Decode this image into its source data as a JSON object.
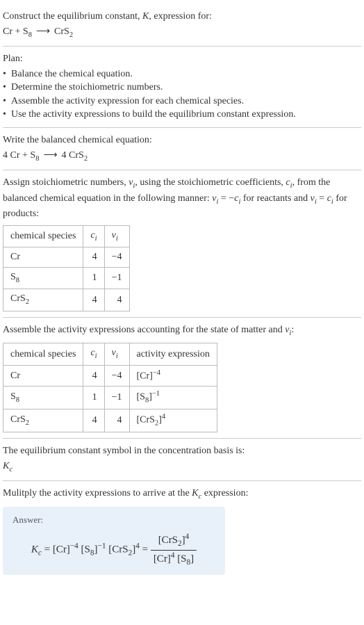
{
  "header": {
    "prompt": "Construct the equilibrium constant, ",
    "Ksym": "K",
    "prompt2": ", expression for:",
    "reactant1": "Cr",
    "plus": " + ",
    "reactant2a": "S",
    "reactant2sub": "8",
    "arrow": "⟶",
    "product1a": "CrS",
    "product1sub": "2"
  },
  "plan": {
    "title": "Plan:",
    "items": [
      "Balance the chemical equation.",
      "Determine the stoichiometric numbers.",
      "Assemble the activity expression for each chemical species.",
      "Use the activity expressions to build the equilibrium constant expression."
    ]
  },
  "balanced": {
    "title": "Write the balanced chemical equation:",
    "c1": "4 Cr",
    "plus": " + ",
    "c2a": "S",
    "c2sub": "8",
    "arrow": "⟶",
    "c3a": "4 CrS",
    "c3sub": "2"
  },
  "stoich": {
    "intro1": "Assign stoichiometric numbers, ",
    "nu": "ν",
    "isub": "i",
    "intro2": ", using the stoichiometric coefficients, ",
    "c": "c",
    "intro3": ", from the balanced chemical equation in the following manner: ",
    "rel1a": "ν",
    "rel1b": " = −",
    "rel1c": "c",
    "intro4": " for reactants and ",
    "rel2a": "ν",
    "rel2b": " = ",
    "rel2c": "c",
    "intro5": " for products:",
    "headers": {
      "h1": "chemical species",
      "h2": "c",
      "h2sub": "i",
      "h3": "ν",
      "h3sub": "i"
    },
    "rows": [
      {
        "sp": "Cr",
        "spsub": "",
        "c": "4",
        "v": "−4"
      },
      {
        "sp": "S",
        "spsub": "8",
        "c": "1",
        "v": "−1"
      },
      {
        "sp": "CrS",
        "spsub": "2",
        "c": "4",
        "v": "4"
      }
    ]
  },
  "activity": {
    "intro1": "Assemble the activity expressions accounting for the state of matter and ",
    "nu": "ν",
    "isub": "i",
    "intro2": ":",
    "headers": {
      "h1": "chemical species",
      "h2": "c",
      "h2sub": "i",
      "h3": "ν",
      "h3sub": "i",
      "h4": "activity expression"
    },
    "rows": [
      {
        "sp": "Cr",
        "spsub": "",
        "c": "4",
        "v": "−4",
        "ae_base": "[Cr]",
        "ae_sup": "−4"
      },
      {
        "sp": "S",
        "spsub": "8",
        "c": "1",
        "v": "−1",
        "ae_base": "[S",
        "ae_bsub": "8",
        "ae_close": "]",
        "ae_sup": "−1"
      },
      {
        "sp": "CrS",
        "spsub": "2",
        "c": "4",
        "v": "4",
        "ae_base": "[CrS",
        "ae_bsub": "2",
        "ae_close": "]",
        "ae_sup": "4"
      }
    ]
  },
  "symbol": {
    "line1": "The equilibrium constant symbol in the concentration basis is:",
    "K": "K",
    "Ksub": "c"
  },
  "multiply": {
    "line1a": "Mulitply the activity expressions to arrive at the ",
    "K": "K",
    "Ksub": "c",
    "line1b": " expression:"
  },
  "answer": {
    "label": "Answer:",
    "K": "K",
    "Ksub": "c",
    "eq": " = ",
    "t1": "[Cr]",
    "t1sup": "−4",
    "sp": " ",
    "t2a": "[S",
    "t2sub": "8",
    "t2b": "]",
    "t2sup": "−1",
    "t3a": "[CrS",
    "t3sub": "2",
    "t3b": "]",
    "t3sup": "4",
    "eq2": " = ",
    "num_a": "[CrS",
    "num_sub": "2",
    "num_b": "]",
    "num_sup": "4",
    "den_a": "[Cr]",
    "den_asup": "4",
    "den_sp": " ",
    "den_b": "[S",
    "den_bsub": "8",
    "den_c": "]"
  }
}
